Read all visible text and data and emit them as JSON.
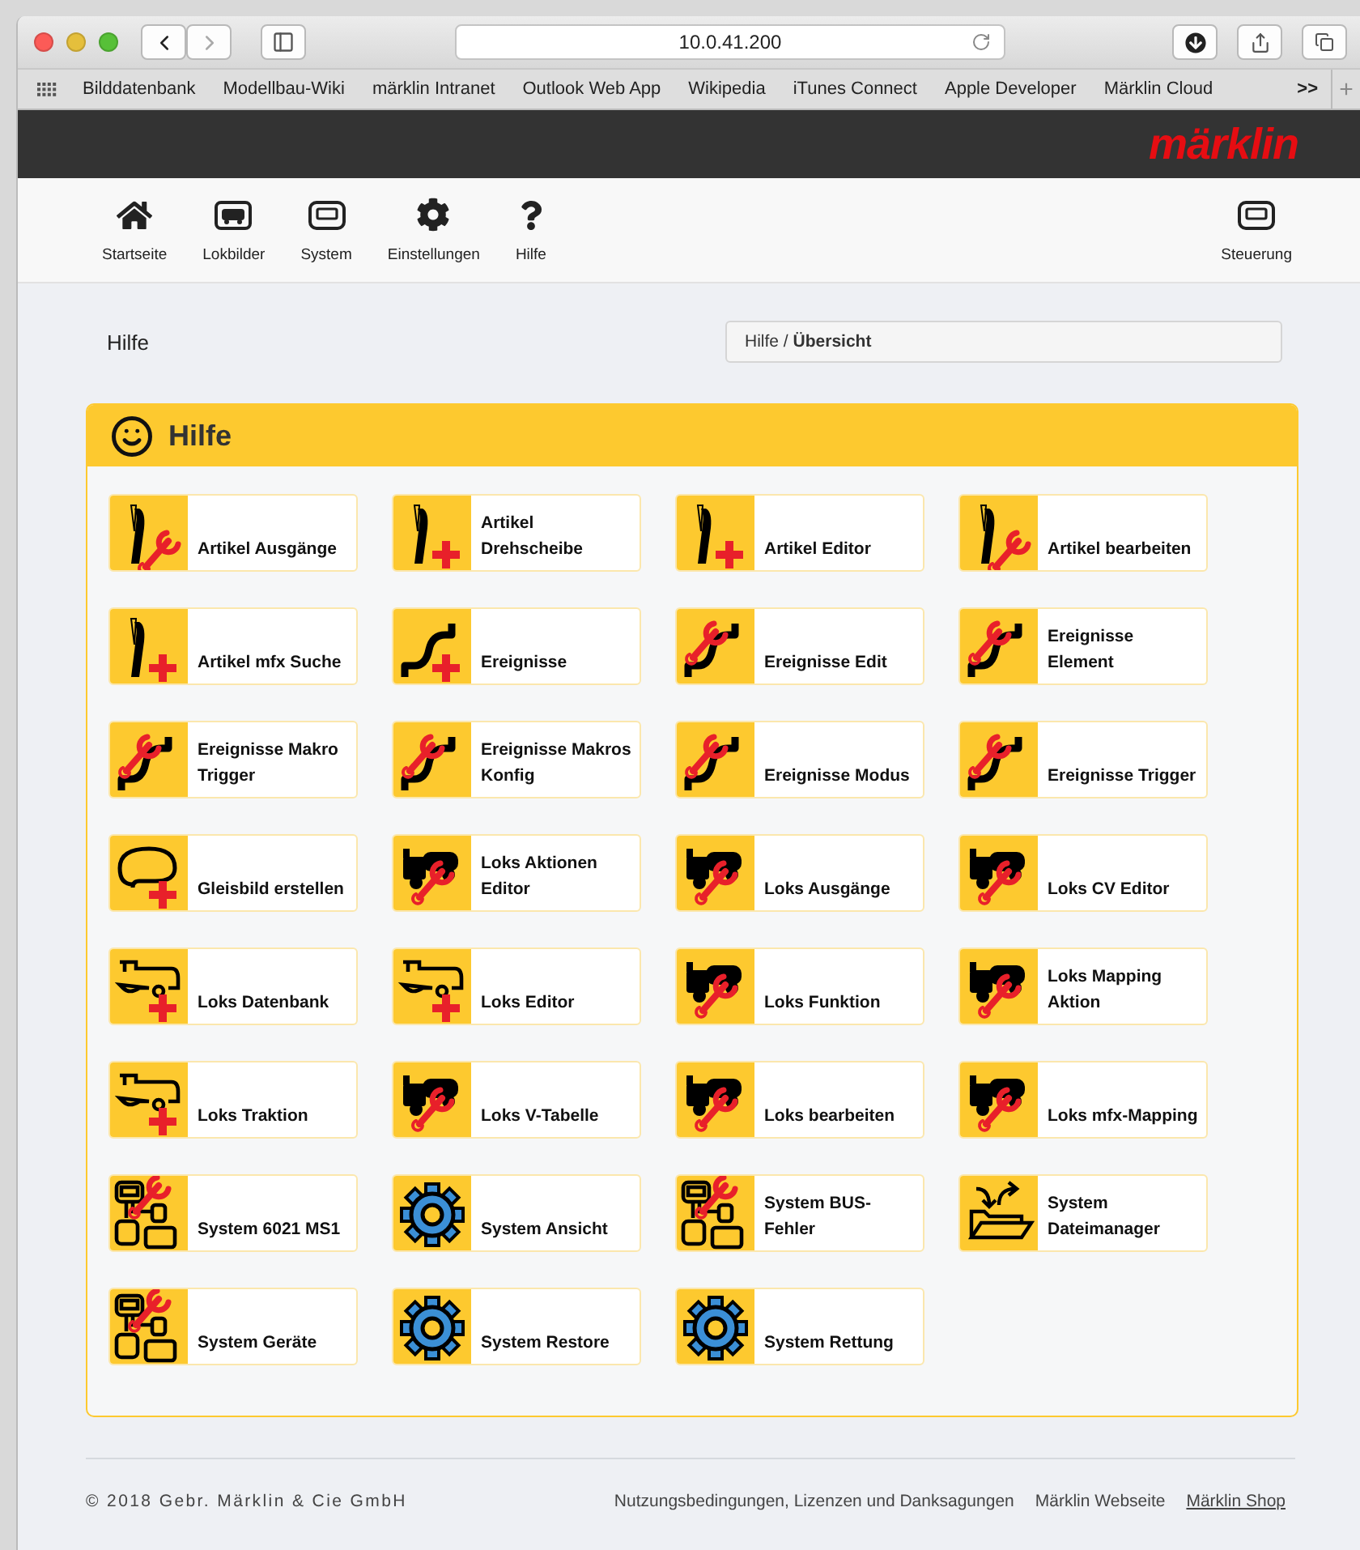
{
  "browser": {
    "address": "10.0.41.200",
    "bookmarks": [
      "Bilddatenbank",
      "Modellbau-Wiki",
      "märklin  Intranet",
      "Outlook Web App",
      "Wikipedia",
      "iTunes Connect",
      "Apple Developer",
      "Märklin Cloud"
    ],
    "overflow": ">>",
    "new_tab": "+"
  },
  "header": {
    "logo": "märklin"
  },
  "nav": {
    "items": [
      {
        "label": "Startseite",
        "kind": "home"
      },
      {
        "label": "Lokbilder",
        "kind": "loco"
      },
      {
        "label": "System",
        "kind": "screen"
      },
      {
        "label": "Einstellungen",
        "kind": "gear"
      },
      {
        "label": "Hilfe",
        "kind": "question"
      }
    ],
    "right": {
      "label": "Steuerung",
      "kind": "screen"
    }
  },
  "page": {
    "title": "Hilfe",
    "breadcrumb": "Hilfe / **Übersicht**"
  },
  "panel": {
    "title": "Hilfe",
    "tiles": [
      {
        "label": "Artikel Ausgänge",
        "kind": "track-wrench"
      },
      {
        "label": "Artikel Drehscheibe",
        "kind": "track-plus"
      },
      {
        "label": "Artikel Editor",
        "kind": "track-plus"
      },
      {
        "label": "Artikel bearbeiten",
        "kind": "track-wrench"
      },
      {
        "label": "Artikel mfx Suche",
        "kind": "track-plus"
      },
      {
        "label": "Ereignisse",
        "kind": "curve-plus"
      },
      {
        "label": "Ereignisse Edit",
        "kind": "curve-wrench"
      },
      {
        "label": "Ereignisse Element",
        "kind": "curve-wrench"
      },
      {
        "label": "Ereignisse Makro Trigger",
        "kind": "curve-wrench"
      },
      {
        "label": "Ereignisse Makros Konfig",
        "kind": "curve-wrench"
      },
      {
        "label": "Ereignisse Modus",
        "kind": "curve-wrench"
      },
      {
        "label": "Ereignisse Trigger",
        "kind": "curve-wrench"
      },
      {
        "label": "Gleisbild erstellen",
        "kind": "loop-plus"
      },
      {
        "label": "Loks Aktionen Editor",
        "kind": "loco-wrench"
      },
      {
        "label": "Loks Ausgänge",
        "kind": "loco-wrench"
      },
      {
        "label": "Loks CV Editor",
        "kind": "loco-wrench"
      },
      {
        "label": "Loks Datenbank",
        "kind": "loco-plus"
      },
      {
        "label": "Loks Editor",
        "kind": "loco-plus"
      },
      {
        "label": "Loks Funktion",
        "kind": "loco-wrench"
      },
      {
        "label": "Loks Mapping Aktion",
        "kind": "loco-wrench"
      },
      {
        "label": "Loks Traktion",
        "kind": "loco-plus"
      },
      {
        "label": "Loks V-Tabelle",
        "kind": "loco-wrench"
      },
      {
        "label": "Loks bearbeiten",
        "kind": "loco-wrench"
      },
      {
        "label": "Loks mfx-Mapping",
        "kind": "loco-wrench"
      },
      {
        "label": "System 6021 MS1",
        "kind": "blocks-wrench"
      },
      {
        "label": "System Ansicht",
        "kind": "gear"
      },
      {
        "label": "System BUS-Fehler",
        "kind": "blocks-wrench"
      },
      {
        "label": "System Dateimanager",
        "kind": "folder"
      },
      {
        "label": "System Geräte",
        "kind": "blocks-wrench"
      },
      {
        "label": "System Restore",
        "kind": "gear"
      },
      {
        "label": "System Rettung",
        "kind": "gear"
      }
    ]
  },
  "footer": {
    "copyright": "© 2018 Gebr. Märklin & Cie GmbH",
    "links": [
      {
        "label": "Nutzungsbedingungen, Lizenzen und Danksagungen",
        "underlined": false
      },
      {
        "label": "Märklin Webseite",
        "underlined": false
      },
      {
        "label": "Märklin Shop",
        "underlined": true
      }
    ]
  }
}
